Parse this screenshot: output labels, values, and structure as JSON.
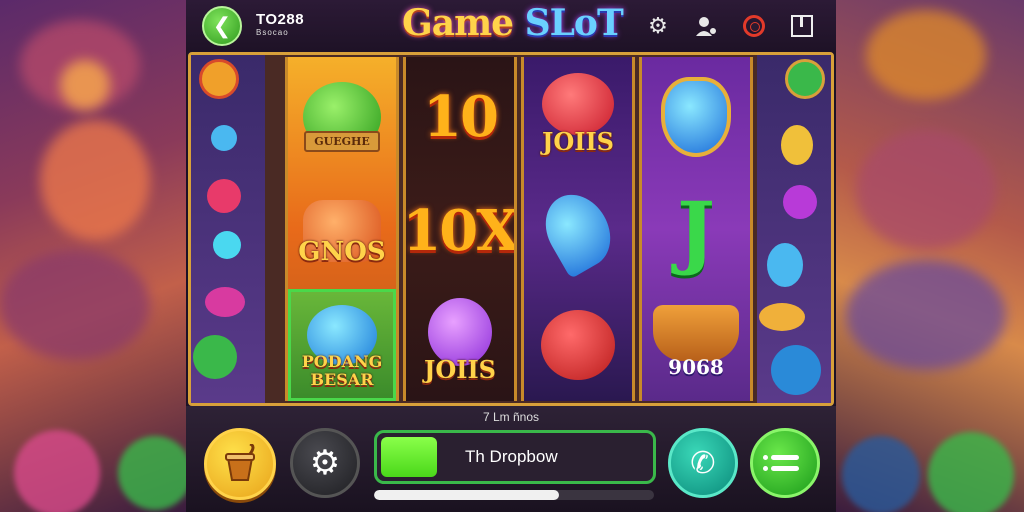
{
  "header": {
    "brand_name": "TO288",
    "brand_sub": "Bsocao",
    "title_part1": "Game",
    "title_part2": "SLoT",
    "icons": [
      "gear-icon",
      "user-icon",
      "record-icon",
      "box-icon"
    ]
  },
  "reels": {
    "reel1": [
      {
        "symbol": "green-apple",
        "label": "GUEGHE"
      },
      {
        "symbol": "orange-dice",
        "label": "GNOS"
      },
      {
        "symbol": "blue-pot",
        "label": "PODANG BESAR"
      }
    ],
    "reel2": [
      {
        "symbol": "number-10",
        "label": "10"
      },
      {
        "symbol": "number-10x",
        "label": "10X"
      },
      {
        "symbol": "purple-bean",
        "label": "JOIIS"
      }
    ],
    "reel3": [
      {
        "symbol": "red-heart",
        "label": "JOIIS"
      },
      {
        "symbol": "blue-leaf",
        "label": ""
      },
      {
        "symbol": "red-apple",
        "label": ""
      }
    ],
    "reel4": [
      {
        "symbol": "blue-shield",
        "label": ""
      },
      {
        "symbol": "green-j",
        "label": ""
      },
      {
        "symbol": "fruit-basket",
        "label": "9068"
      }
    ]
  },
  "bottom": {
    "bet_label": "7 Lm ñnos",
    "spin_label": "Th Dropbow",
    "spin_fill_fraction": 0.2,
    "progress_fraction": 0.66,
    "buttons": [
      "bucket-icon",
      "gear-icon",
      "phone-icon",
      "menu-icon"
    ]
  },
  "colors": {
    "accent_green": "#3ab84a",
    "gold": "#ffd34a",
    "frame_gold": "#d8a03a"
  }
}
